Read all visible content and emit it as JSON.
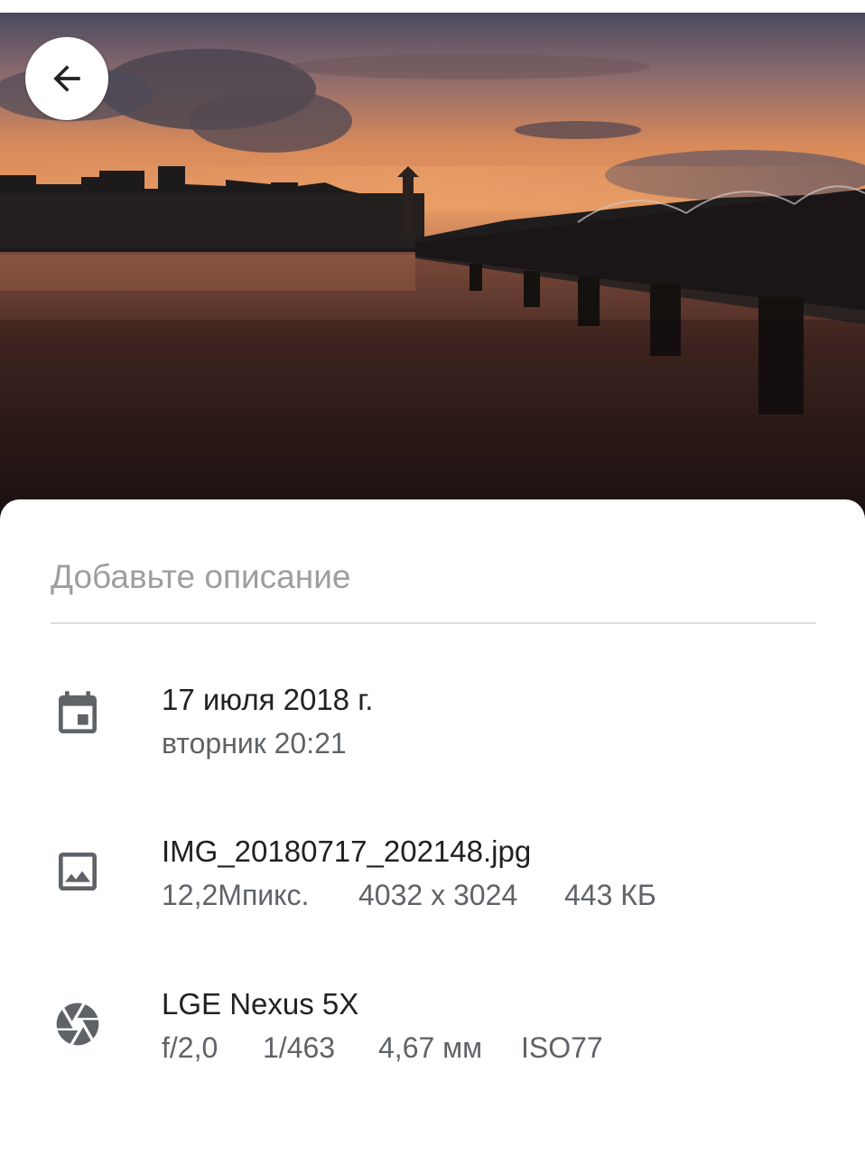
{
  "photo": {
    "name": "sunset-over-river-photo"
  },
  "back_button": {
    "icon": "arrow-left-icon"
  },
  "description": {
    "placeholder": "Добавьте описание"
  },
  "date": {
    "icon": "calendar-icon",
    "title": "17 июля 2018 г.",
    "subtitle": "вторник 20:21"
  },
  "file": {
    "icon": "image-icon",
    "title": "IMG_20180717_202148.jpg",
    "megapixels": "12,2Мпикс.",
    "resolution": "4032 x 3024",
    "size": "443 КБ"
  },
  "camera": {
    "icon": "aperture-icon",
    "title": "LGE Nexus 5X",
    "aperture": "f/2,0",
    "shutter": "1/463",
    "focal_length": "4,67 мм",
    "iso": "ISO77"
  },
  "colors": {
    "icon": "#5f6368",
    "title": "#202124",
    "subtitle": "#5f6368",
    "placeholder": "#9e9e9e"
  }
}
